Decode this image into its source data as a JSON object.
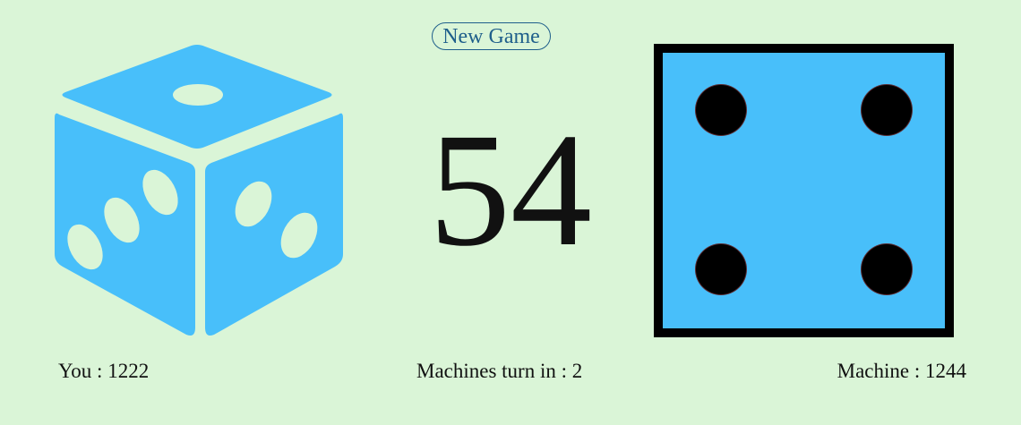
{
  "header": {
    "new_game_label": "New Game"
  },
  "player": {
    "label": "You : 1222",
    "score": 1222,
    "dice_icon": "dice-3d-icon"
  },
  "center": {
    "countdown": "54",
    "turn_info": "Machines turn in : 2"
  },
  "machine": {
    "label": "Machine : 1244",
    "score": 1244,
    "die_value": 4
  },
  "colors": {
    "background": "#daf5d7",
    "dice_blue": "#48bffa",
    "button_text": "#1f5f8b",
    "pip": "#000000"
  }
}
